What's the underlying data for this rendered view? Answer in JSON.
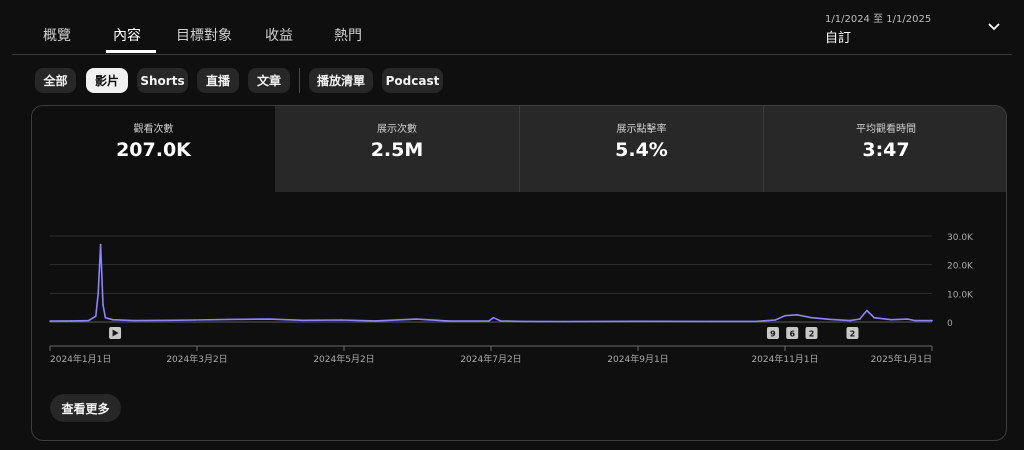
{
  "tabs": [
    {
      "label": "概覽"
    },
    {
      "label": "內容"
    },
    {
      "label": "目標對象"
    },
    {
      "label": "收益"
    },
    {
      "label": "熱門"
    }
  ],
  "date_range": {
    "range": "1/1/2024 至 1/1/2025",
    "mode": "自訂"
  },
  "chips": [
    {
      "label": "全部"
    },
    {
      "label": "影片"
    },
    {
      "label": "Shorts"
    },
    {
      "label": "直播"
    },
    {
      "label": "文章"
    },
    {
      "label": "播放清單"
    },
    {
      "label": "Podcast"
    }
  ],
  "metrics": [
    {
      "label": "觀看次數",
      "value": "207.0K"
    },
    {
      "label": "展示次數",
      "value": "2.5M"
    },
    {
      "label": "展示點擊率",
      "value": "5.4%"
    },
    {
      "label": "平均觀看時間",
      "value": "3:47"
    }
  ],
  "see_more": "查看更多",
  "colors": {
    "line": "#8c85ff",
    "accent": "#ffffff",
    "background": "#0f0f0f"
  },
  "chart_data": {
    "type": "line",
    "series": [
      {
        "x": [
          "2024-01-01",
          "2024-01-10",
          "2024-01-17",
          "2024-01-20",
          "2024-01-21",
          "2024-01-22",
          "2024-01-23",
          "2024-01-24",
          "2024-01-27",
          "2024-02-05",
          "2024-02-20",
          "2024-03-01",
          "2024-03-15",
          "2024-04-01",
          "2024-04-15",
          "2024-05-01",
          "2024-05-15",
          "2024-06-01",
          "2024-06-15",
          "2024-07-01",
          "2024-07-03",
          "2024-07-06",
          "2024-07-15",
          "2024-08-01",
          "2024-09-01",
          "2024-10-01",
          "2024-10-20",
          "2024-10-28",
          "2024-11-01",
          "2024-11-06",
          "2024-11-12",
          "2024-11-20",
          "2024-11-28",
          "2024-12-02",
          "2024-12-05",
          "2024-12-08",
          "2024-12-15",
          "2024-12-22",
          "2024-12-25",
          "2025-01-01"
        ],
        "y": [
          300,
          400,
          500,
          2000,
          10000,
          27000,
          6000,
          1500,
          800,
          500,
          600,
          700,
          900,
          1000,
          600,
          700,
          400,
          1000,
          300,
          300,
          1500,
          400,
          200,
          150,
          250,
          200,
          200,
          700,
          2200,
          2500,
          1500,
          900,
          500,
          1000,
          4000,
          1500,
          800,
          1000,
          500,
          500
        ]
      }
    ],
    "y_ticks": [
      "0",
      "10.0K",
      "20.0K",
      "30.0K"
    ],
    "y_tick_values": [
      0,
      10000,
      20000,
      30000
    ],
    "ylim": [
      0,
      30000
    ],
    "xlim": [
      "2024-01-01",
      "2025-01-01"
    ],
    "x_ticks": [
      {
        "date": "2024-01-01",
        "label": "2024年1月1日"
      },
      {
        "date": "2024-03-02",
        "label": "2024年3月2日"
      },
      {
        "date": "2024-05-02",
        "label": "2024年5月2日"
      },
      {
        "date": "2024-07-02",
        "label": "2024年7月2日"
      },
      {
        "date": "2024-09-01",
        "label": "2024年9月1日"
      },
      {
        "date": "2024-11-01",
        "label": "2024年11月1日"
      },
      {
        "date": "2025-01-01",
        "label": "2025年1月1日"
      }
    ],
    "markers": [
      {
        "date": "2024-01-28",
        "label": "",
        "icon": "play-icon"
      },
      {
        "date": "2024-10-27",
        "label": "9"
      },
      {
        "date": "2024-11-04",
        "label": "6"
      },
      {
        "date": "2024-11-12",
        "label": "2"
      },
      {
        "date": "2024-11-29",
        "label": "2"
      }
    ],
    "grid": true
  }
}
